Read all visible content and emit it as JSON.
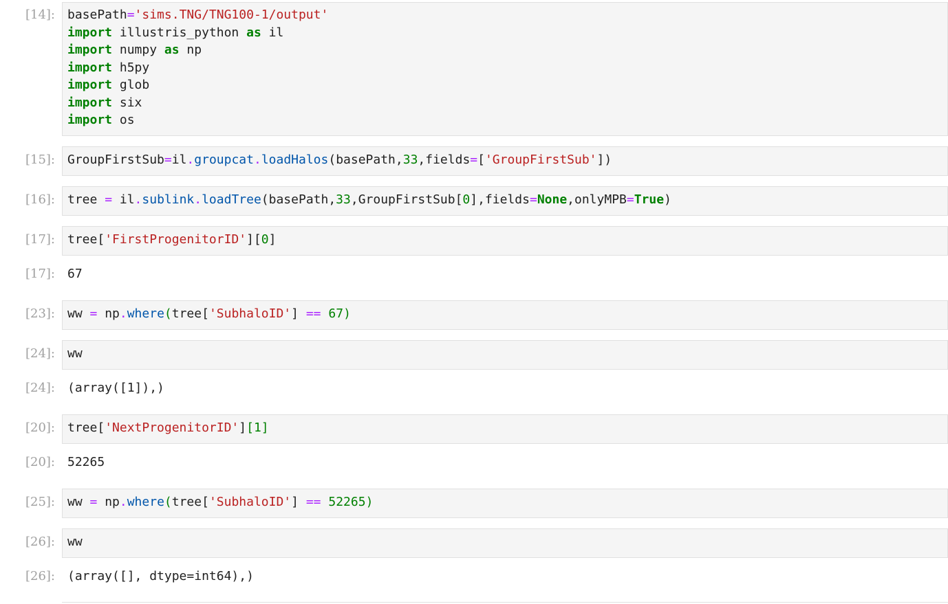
{
  "cells": [
    {
      "prompt": "[14]:",
      "lines": [
        [
          {
            "t": "basePath",
            "c": "plain"
          },
          {
            "t": "=",
            "c": "op"
          },
          {
            "t": "'sims.TNG/TNG100-1/output'",
            "c": "str"
          }
        ],
        [
          {
            "t": "import",
            "c": "kw"
          },
          {
            "t": " illustris_python ",
            "c": "plain"
          },
          {
            "t": "as",
            "c": "kw"
          },
          {
            "t": " il",
            "c": "plain"
          }
        ],
        [
          {
            "t": "import",
            "c": "kw"
          },
          {
            "t": " numpy ",
            "c": "plain"
          },
          {
            "t": "as",
            "c": "kw"
          },
          {
            "t": " np",
            "c": "plain"
          }
        ],
        [
          {
            "t": "import",
            "c": "kw"
          },
          {
            "t": " h5py",
            "c": "plain"
          }
        ],
        [
          {
            "t": "import",
            "c": "kw"
          },
          {
            "t": " glob",
            "c": "plain"
          }
        ],
        [
          {
            "t": "import",
            "c": "kw"
          },
          {
            "t": " six",
            "c": "plain"
          }
        ],
        [
          {
            "t": "import",
            "c": "kw"
          },
          {
            "t": " os",
            "c": "plain"
          }
        ]
      ]
    },
    {
      "prompt": "[15]:",
      "lines": [
        [
          {
            "t": "GroupFirstSub",
            "c": "plain"
          },
          {
            "t": "=",
            "c": "op"
          },
          {
            "t": "il",
            "c": "plain"
          },
          {
            "t": ".",
            "c": "op"
          },
          {
            "t": "groupcat",
            "c": "attr"
          },
          {
            "t": ".",
            "c": "op"
          },
          {
            "t": "loadHalos",
            "c": "attr"
          },
          {
            "t": "(basePath,",
            "c": "plain"
          },
          {
            "t": "33",
            "c": "num"
          },
          {
            "t": ",fields",
            "c": "plain"
          },
          {
            "t": "=",
            "c": "op"
          },
          {
            "t": "[",
            "c": "plain"
          },
          {
            "t": "'GroupFirstSub'",
            "c": "str"
          },
          {
            "t": "])",
            "c": "plain"
          }
        ]
      ]
    },
    {
      "prompt": "[16]:",
      "lines": [
        [
          {
            "t": "tree ",
            "c": "plain"
          },
          {
            "t": "=",
            "c": "op"
          },
          {
            "t": " il",
            "c": "plain"
          },
          {
            "t": ".",
            "c": "op"
          },
          {
            "t": "sublink",
            "c": "attr"
          },
          {
            "t": ".",
            "c": "op"
          },
          {
            "t": "loadTree",
            "c": "attr"
          },
          {
            "t": "(basePath,",
            "c": "plain"
          },
          {
            "t": "33",
            "c": "num"
          },
          {
            "t": ",GroupFirstSub[",
            "c": "plain"
          },
          {
            "t": "0",
            "c": "num"
          },
          {
            "t": "],fields",
            "c": "plain"
          },
          {
            "t": "=",
            "c": "op"
          },
          {
            "t": "None",
            "c": "kw"
          },
          {
            "t": ",onlyMPB",
            "c": "plain"
          },
          {
            "t": "=",
            "c": "op"
          },
          {
            "t": "True",
            "c": "kw"
          },
          {
            "t": ")",
            "c": "plain"
          }
        ]
      ]
    },
    {
      "prompt": "[17]:",
      "lines": [
        [
          {
            "t": "tree[",
            "c": "plain"
          },
          {
            "t": "'FirstProgenitorID'",
            "c": "str"
          },
          {
            "t": "][",
            "c": "plain"
          },
          {
            "t": "0",
            "c": "num"
          },
          {
            "t": "]",
            "c": "plain"
          }
        ]
      ],
      "output": {
        "prompt": "[17]:",
        "text": "67"
      }
    },
    {
      "prompt": "[23]:",
      "lines": [
        [
          {
            "t": "ww ",
            "c": "plain"
          },
          {
            "t": "=",
            "c": "op"
          },
          {
            "t": " np",
            "c": "plain"
          },
          {
            "t": ".",
            "c": "op"
          },
          {
            "t": "where",
            "c": "attr"
          },
          {
            "t": "(",
            "c": "bracket-hi"
          },
          {
            "t": "tree[",
            "c": "plain"
          },
          {
            "t": "'SubhaloID'",
            "c": "str"
          },
          {
            "t": "] ",
            "c": "plain"
          },
          {
            "t": "==",
            "c": "op"
          },
          {
            "t": " ",
            "c": "plain"
          },
          {
            "t": "67",
            "c": "num"
          },
          {
            "t": ")",
            "c": "bracket-hi"
          }
        ]
      ]
    },
    {
      "prompt": "[24]:",
      "lines": [
        [
          {
            "t": "ww",
            "c": "plain"
          }
        ]
      ],
      "output": {
        "prompt": "[24]:",
        "text": "(array([1]),)"
      }
    },
    {
      "prompt": "[20]:",
      "lines": [
        [
          {
            "t": "tree[",
            "c": "plain"
          },
          {
            "t": "'NextProgenitorID'",
            "c": "str"
          },
          {
            "t": "]",
            "c": "plain"
          },
          {
            "t": "[",
            "c": "bracket-hi"
          },
          {
            "t": "1",
            "c": "num"
          },
          {
            "t": "]",
            "c": "bracket-hi"
          }
        ]
      ],
      "output": {
        "prompt": "[20]:",
        "text": "52265"
      }
    },
    {
      "prompt": "[25]:",
      "lines": [
        [
          {
            "t": "ww ",
            "c": "plain"
          },
          {
            "t": "=",
            "c": "op"
          },
          {
            "t": " np",
            "c": "plain"
          },
          {
            "t": ".",
            "c": "op"
          },
          {
            "t": "where",
            "c": "attr"
          },
          {
            "t": "(",
            "c": "bracket-hi"
          },
          {
            "t": "tree[",
            "c": "plain"
          },
          {
            "t": "'SubhaloID'",
            "c": "str"
          },
          {
            "t": "] ",
            "c": "plain"
          },
          {
            "t": "==",
            "c": "op"
          },
          {
            "t": " ",
            "c": "plain"
          },
          {
            "t": "52265",
            "c": "num"
          },
          {
            "t": ")",
            "c": "bracket-hi"
          }
        ]
      ]
    },
    {
      "prompt": "[26]:",
      "lines": [
        [
          {
            "t": "ww",
            "c": "plain"
          }
        ]
      ],
      "output": {
        "prompt": "[26]:",
        "text": "(array([], dtype=int64),)"
      }
    }
  ]
}
